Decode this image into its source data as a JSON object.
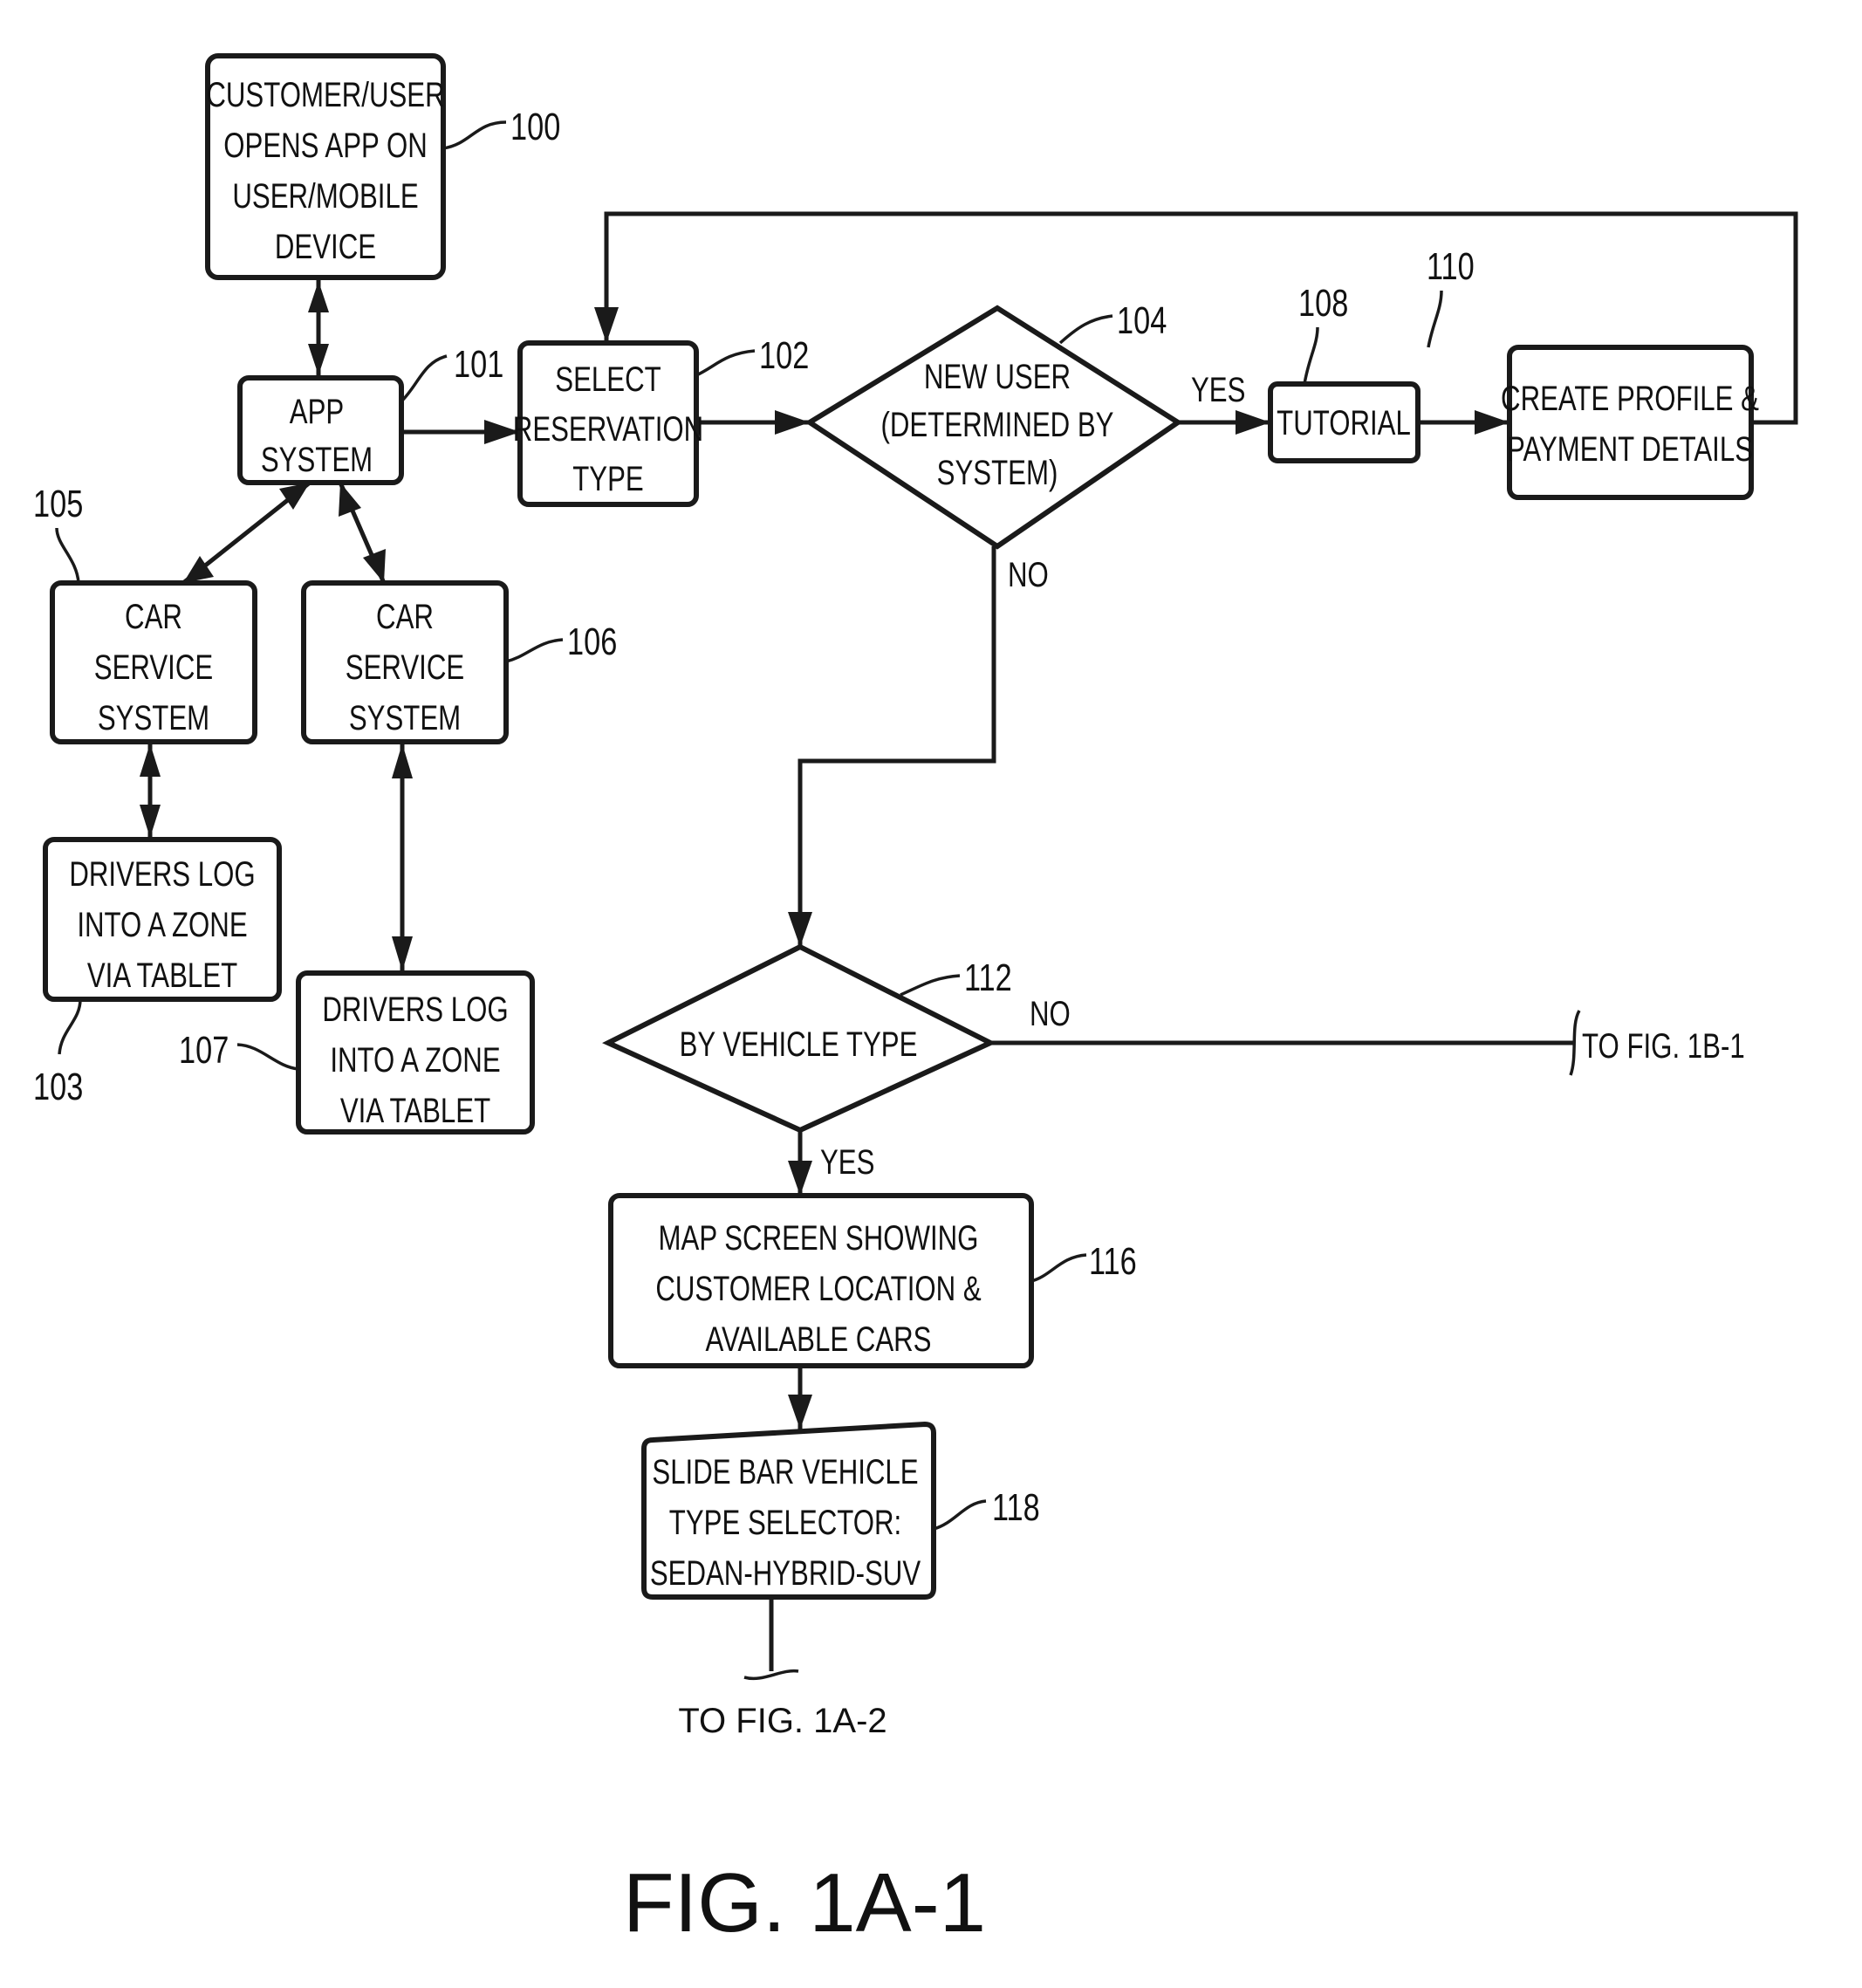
{
  "figure": {
    "title": "FIG. 1A-1"
  },
  "nodes": {
    "n100": {
      "ref": "100",
      "lines": [
        "CUSTOMER/USER",
        "OPENS APP ON",
        "USER/MOBILE",
        "DEVICE"
      ]
    },
    "n101": {
      "ref": "101",
      "lines": [
        "APP",
        "SYSTEM"
      ]
    },
    "n102": {
      "ref": "102",
      "lines": [
        "SELECT",
        "RESERVATION",
        "TYPE"
      ]
    },
    "n104": {
      "ref": "104",
      "lines": [
        "NEW USER",
        "(DETERMINED BY",
        "SYSTEM)"
      ]
    },
    "n105": {
      "ref": "105",
      "lines": [
        "CAR",
        "SERVICE",
        "SYSTEM"
      ]
    },
    "n106": {
      "ref": "106",
      "lines": [
        "CAR",
        "SERVICE",
        "SYSTEM"
      ]
    },
    "n103": {
      "ref": "103",
      "lines": [
        "DRIVERS LOG",
        "INTO A ZONE",
        "VIA TABLET"
      ]
    },
    "n107": {
      "ref": "107",
      "lines": [
        "DRIVERS LOG",
        "INTO A ZONE",
        "VIA TABLET"
      ]
    },
    "n108": {
      "ref": "108",
      "lines": [
        "TUTORIAL"
      ]
    },
    "n110": {
      "ref": "110",
      "lines": [
        "CREATE PROFILE &",
        "PAYMENT DETAILS"
      ]
    },
    "n112": {
      "ref": "112",
      "lines": [
        "BY VEHICLE TYPE"
      ]
    },
    "n116": {
      "ref": "116",
      "lines": [
        "MAP SCREEN SHOWING",
        "CUSTOMER LOCATION &",
        "AVAILABLE CARS"
      ]
    },
    "n118": {
      "ref": "118",
      "lines": [
        "SLIDE BAR VEHICLE",
        "TYPE SELECTOR:",
        "SEDAN-HYBRID-SUV"
      ]
    }
  },
  "edge_labels": {
    "yes_104": "YES",
    "no_104": "NO",
    "yes_112": "YES",
    "no_112": "NO"
  },
  "connectors": {
    "to_1b1": "TO FIG. 1B-1",
    "to_1a2": "TO FIG. 1A-2"
  }
}
